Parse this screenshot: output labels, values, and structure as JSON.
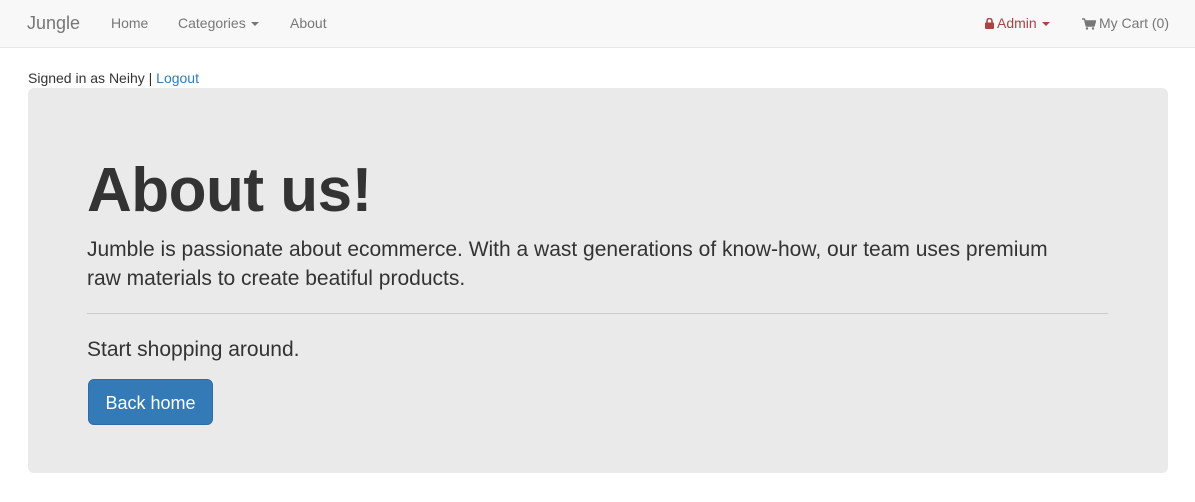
{
  "navbar": {
    "brand": "Jungle",
    "items": [
      {
        "label": "Home"
      },
      {
        "label": "Categories"
      },
      {
        "label": "About"
      }
    ],
    "admin_label": "Admin",
    "cart_label": "My Cart (0)",
    "admin_icon": "lock-icon",
    "cart_icon": "shopping-cart-icon"
  },
  "session": {
    "signed_in_text": "Signed in as Neihy |",
    "logout_label": "Logout"
  },
  "jumbotron": {
    "title": "About us!",
    "lead": "Jumble is passionate about ecommerce. With a wast generations of know-how, our team uses premium raw materials to create beatiful products.",
    "subtext": "Start shopping around.",
    "button_label": "Back home"
  },
  "colors": {
    "navbar_bg": "#f8f8f8",
    "jumbotron_bg": "#eaeaea",
    "primary": "#337ab7",
    "admin": "#a94442",
    "link": "#337ab7"
  }
}
